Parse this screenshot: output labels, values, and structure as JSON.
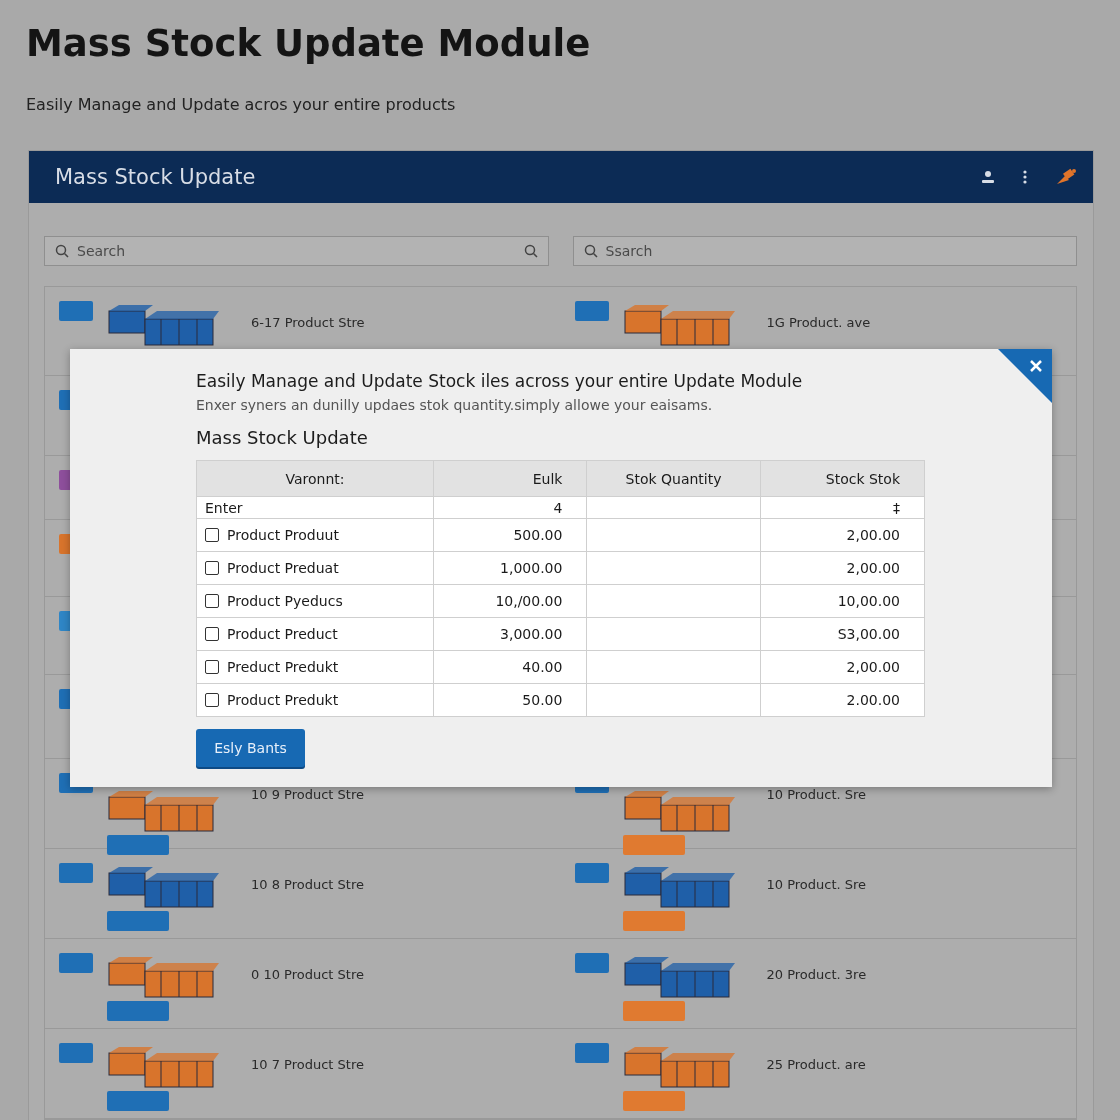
{
  "page": {
    "title": "Mass Stock Update Module",
    "subtitle": "Easily Manage and Update acros your entire products"
  },
  "panel": {
    "title": "Mass Stock Update"
  },
  "searches": [
    {
      "placeholder": "Search",
      "trailing_icon": true
    },
    {
      "placeholder": "Ssarch",
      "trailing_icon": false
    }
  ],
  "top_row": [
    {
      "tag": {
        "color": "#1f6fb5"
      },
      "kind": "blue",
      "label": "6-17 Product Stre"
    },
    {
      "tag": {
        "color": "#1f6fb5"
      },
      "kind": "orange",
      "label": "1G Product. ave"
    }
  ],
  "covered_rows": [
    {
      "color": "#1f6fb5"
    },
    {
      "color": "#8e4f9c"
    },
    {
      "color": "#d8742c"
    },
    {
      "color": "#2f86c6"
    },
    {
      "color": "#1f6fb5"
    }
  ],
  "rows": [
    [
      {
        "tag": {
          "color": "#1f6fb5"
        },
        "kind": "orange",
        "chip": {
          "color": "#1f6fb5"
        },
        "label": "10 9 Product Stre"
      },
      {
        "tag": {
          "color": "#1f6fb5"
        },
        "kind": "orange",
        "chip": {
          "color": "#e07a30"
        },
        "label": "10 Product. Sre"
      }
    ],
    [
      {
        "tag": {
          "color": "#1f6fb5"
        },
        "kind": "blue",
        "chip": {
          "color": "#1f6fb5"
        },
        "label": "10 8 Product Stre"
      },
      {
        "tag": {
          "color": "#1f6fb5"
        },
        "kind": "blue",
        "chip": {
          "color": "#e07a30"
        },
        "label": "10 Product. Sre"
      }
    ],
    [
      {
        "tag": {
          "color": "#1f6fb5"
        },
        "kind": "orange",
        "chip": {
          "color": "#1f6fb5"
        },
        "label": "0 10 Product Stre"
      },
      {
        "tag": {
          "color": "#1f6fb5"
        },
        "kind": "blue",
        "chip": {
          "color": "#e07a30"
        },
        "label": "20 Product. 3re"
      }
    ],
    [
      {
        "tag": {
          "color": "#1f6fb5"
        },
        "kind": "orange",
        "chip": {
          "color": "#1f6fb5"
        },
        "label": "10 7 Product Stre"
      },
      {
        "tag": {
          "color": "#1f6fb5"
        },
        "kind": "orange",
        "chip": {
          "color": "#e07a30"
        },
        "label": "25 Product. are"
      }
    ]
  ],
  "modal": {
    "title": "Easily Manage and Update Stock iles across your entire Update Module",
    "description": "Enxer syners an dunilly updaes stok quantity.simply allowe your eaisams.",
    "heading": "Mass Stock Update",
    "table": {
      "columns": [
        "Varonnt:",
        "Eulk",
        "Stok Quantity",
        "Stock Stok"
      ],
      "entry_row": {
        "variant": "Enter",
        "bulk": "4",
        "stock": "‡"
      },
      "rows": [
        {
          "checked": false,
          "variant": "Product Produut",
          "bulk": "500.00",
          "stock": "2,00.00"
        },
        {
          "checked": false,
          "variant": "Product Preduat",
          "bulk": "1,000.00",
          "stock": "2,00.00"
        },
        {
          "checked": false,
          "variant": "Product Pyeducs",
          "bulk": "10,/00.00",
          "stock": "10,00.00"
        },
        {
          "checked": false,
          "variant": "Product Preduct",
          "bulk": "3,000.00",
          "stock": "S3,00.00"
        },
        {
          "checked": false,
          "variant": "Preduct Predukt",
          "bulk": "40.00",
          "stock": "2,00.00"
        },
        {
          "checked": false,
          "variant": "Product Predukt",
          "bulk": "50.00",
          "stock": "2.00.00"
        }
      ]
    },
    "button": "Esly Bants"
  }
}
